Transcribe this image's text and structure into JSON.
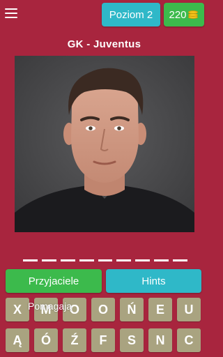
{
  "header": {
    "level_label": "Poziom 2",
    "coins": "220"
  },
  "question": {
    "hint": "GK - Juventus",
    "answer_length": 9
  },
  "buttons": {
    "friends_label": "Przyjaciele",
    "hints_label": "Hints",
    "help_label": "Pomagają"
  },
  "keyboard": {
    "row1": [
      "X",
      "M",
      "O",
      "O",
      "Ń",
      "E",
      "U"
    ],
    "row2": [
      "Ą",
      "Ó",
      "Ź",
      "F",
      "S",
      "N",
      "C"
    ]
  },
  "colors": {
    "background": "#a8253e",
    "level_badge": "#2fb8c8",
    "coins_badge": "#3cba4c",
    "key": "#a9a380"
  }
}
